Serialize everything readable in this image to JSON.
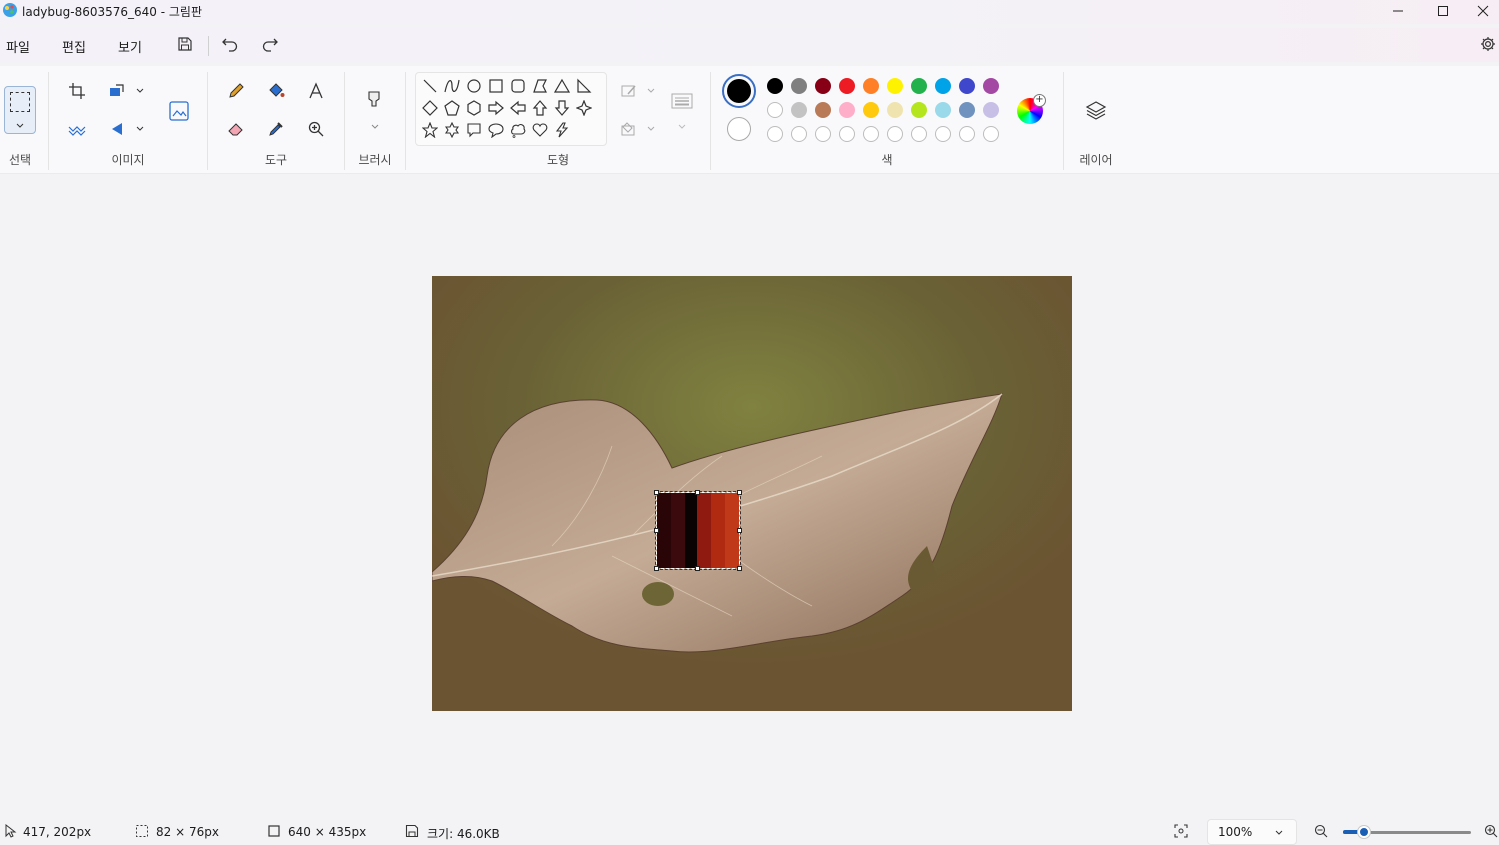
{
  "window": {
    "title": "ladybug-8603576_640 - 그림판"
  },
  "menu": {
    "file": "파일",
    "edit": "편집",
    "view": "보기"
  },
  "ribbon": {
    "groups": {
      "select": "선택",
      "image": "이미지",
      "tools": "도구",
      "brushes": "브러시",
      "shapes": "도형",
      "colors": "색",
      "layers": "레이어"
    },
    "primary_color": "#000000",
    "secondary_color": "#ffffff",
    "palette_row1": [
      "#000000",
      "#7f7f7f",
      "#880015",
      "#ed1c24",
      "#ff7f27",
      "#fff200",
      "#22b14c",
      "#00a2e8",
      "#3f48cc",
      "#a349a4"
    ],
    "palette_row2": [
      "#ffffff",
      "#c3c3c3",
      "#b97a57",
      "#ffaec9",
      "#ffc90e",
      "#efe4b0",
      "#b5e61d",
      "#99d9ea",
      "#7092be",
      "#c8bfe7"
    ]
  },
  "selection_swatch": [
    "#2a0508",
    "#3a0a0d",
    "#0a0303",
    "#8e1a10",
    "#b02a12",
    "#c03a1a"
  ],
  "status": {
    "cursor_pos": "417, 202px",
    "selection_size": "82 × 76px",
    "canvas_size": "640 × 435px",
    "file_size": "크기: 46.0KB",
    "zoom": "100%"
  }
}
